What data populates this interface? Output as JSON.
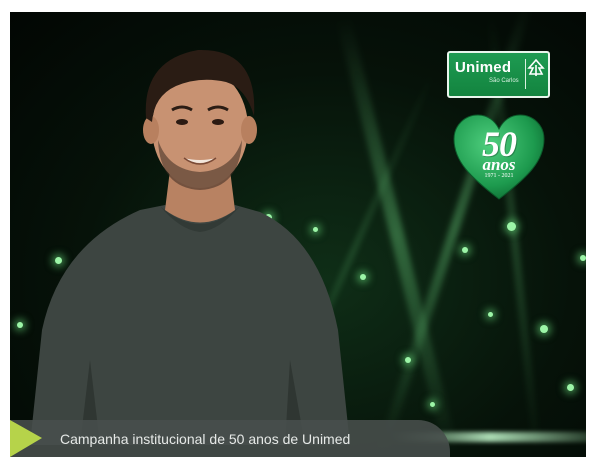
{
  "logo": {
    "name": "Unimed",
    "location": "São Carlos"
  },
  "badge": {
    "number": "50",
    "word": "anos",
    "years": "1971 - 2021"
  },
  "caption": {
    "text": "Campanha institucional de 50 anos de Unimed"
  },
  "colors": {
    "brand_green": "#1e9b52",
    "caption_bg": "#484e4c",
    "caption_arrow": "#b6d34a"
  }
}
